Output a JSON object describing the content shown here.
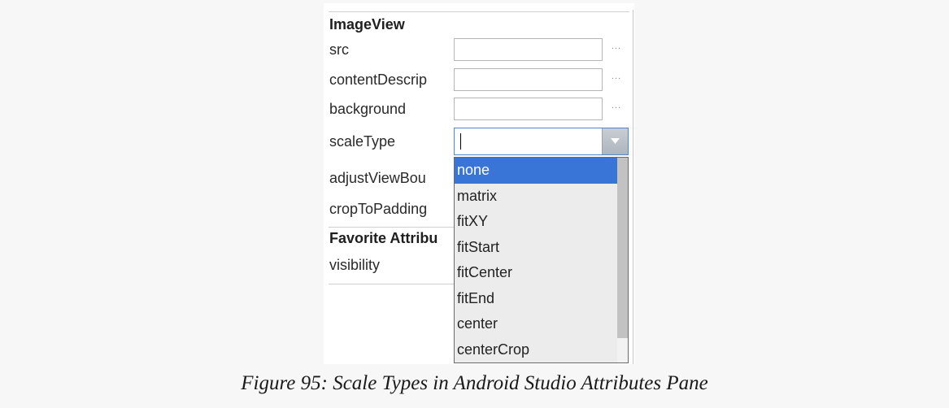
{
  "attributes_pane": {
    "section_imageview": "ImageView",
    "rows": [
      {
        "label": "src",
        "value": "",
        "ellipsis": "..."
      },
      {
        "label": "contentDescrip",
        "value": "",
        "ellipsis": "..."
      },
      {
        "label": "background",
        "value": "",
        "ellipsis": "..."
      }
    ],
    "scale_type_label": "scaleType",
    "scale_type_value": "",
    "adjust_view_bounds_label": "adjustViewBou",
    "crop_to_padding_label": "cropToPadding",
    "section_favorites": "Favorite Attribu",
    "visibility_label": "visibility"
  },
  "scale_type_dropdown": {
    "selected": "none",
    "options": [
      "none",
      "matrix",
      "fitXY",
      "fitStart",
      "fitCenter",
      "fitEnd",
      "center",
      "centerCrop"
    ]
  },
  "caption": "Figure 95: Scale Types in Android Studio Attributes Pane",
  "colors": {
    "selection": "#3875d7",
    "combo_border": "#4f87c9"
  }
}
